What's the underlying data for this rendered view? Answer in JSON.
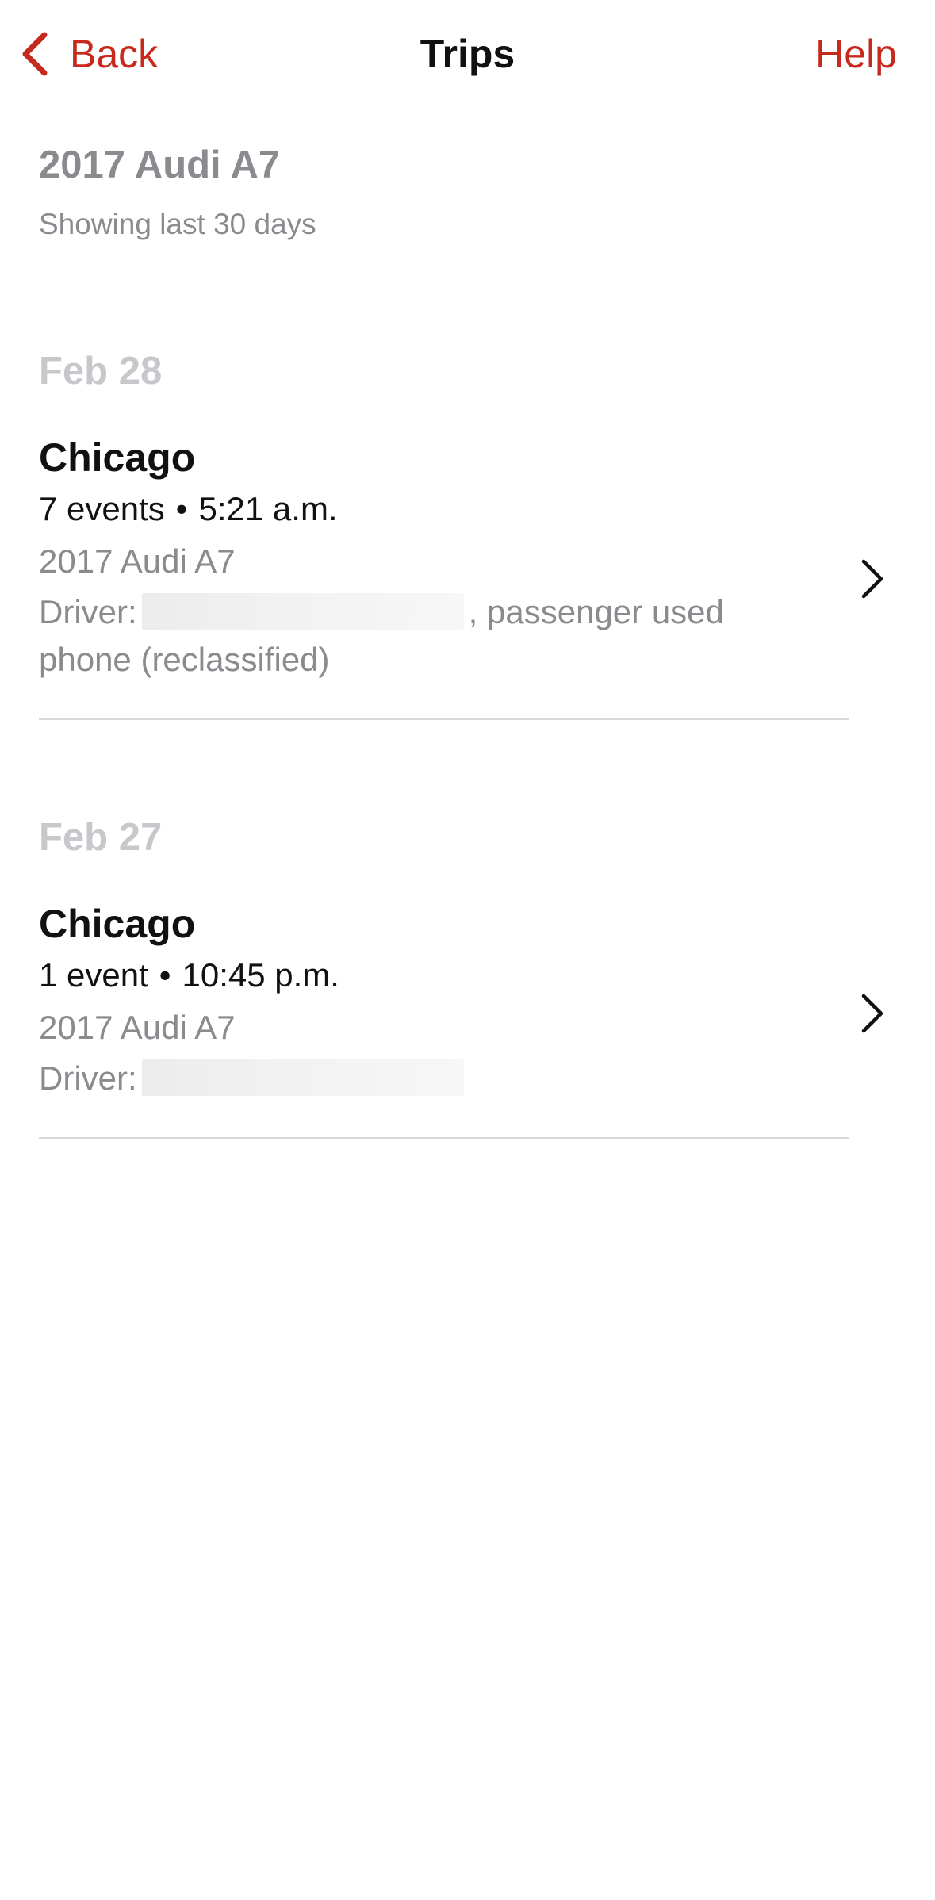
{
  "nav": {
    "back_label": "Back",
    "title": "Trips",
    "help_label": "Help"
  },
  "vehicle": {
    "title": "2017 Audi A7",
    "subtitle": "Showing last 30 days"
  },
  "trips": [
    {
      "date": "Feb 28",
      "city": "Chicago",
      "events": "7 events",
      "time": "5:21 a.m.",
      "vehicle": "2017 Audi A7",
      "driver_label": "Driver:",
      "driver_note": ", passenger used phone (reclassified)"
    },
    {
      "date": "Feb 27",
      "city": "Chicago",
      "events": "1 event",
      "time": "10:45 p.m.",
      "vehicle": "2017 Audi A7",
      "driver_label": "Driver:",
      "driver_note": ""
    }
  ],
  "colors": {
    "accent": "#c62a1d",
    "secondary_text": "#8a8a8f",
    "date_header": "#c8c8cc",
    "divider": "#d9d9dc"
  },
  "icons": {
    "back": "chevron-left-icon",
    "row_chevron": "chevron-right-icon"
  }
}
